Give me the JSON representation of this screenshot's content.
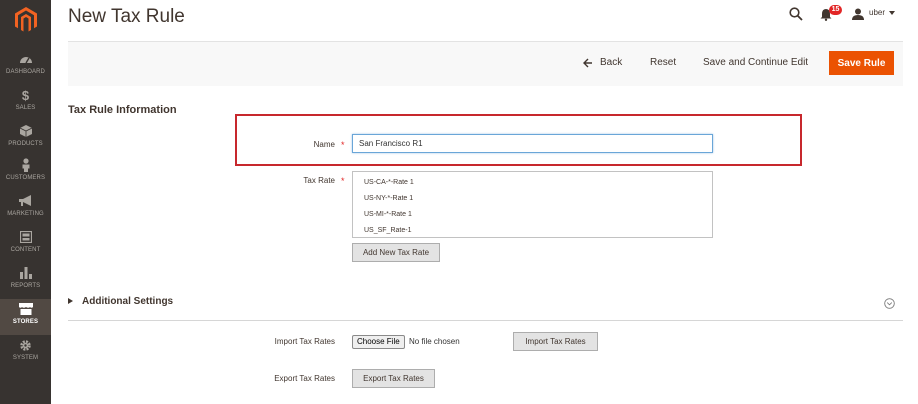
{
  "header": {
    "title": "New Tax Rule",
    "notifications_count": "15",
    "username": "uber"
  },
  "sidebar": {
    "items": [
      {
        "label": "DASHBOARD",
        "icon": "dashboard-icon"
      },
      {
        "label": "SALES",
        "icon": "dollar-icon"
      },
      {
        "label": "PRODUCTS",
        "icon": "cube-icon"
      },
      {
        "label": "CUSTOMERS",
        "icon": "person-icon"
      },
      {
        "label": "MARKETING",
        "icon": "megaphone-icon"
      },
      {
        "label": "CONTENT",
        "icon": "layout-icon"
      },
      {
        "label": "REPORTS",
        "icon": "bar-chart-icon"
      },
      {
        "label": "STORES",
        "icon": "store-icon",
        "active": true
      },
      {
        "label": "SYSTEM",
        "icon": "gear-icon"
      }
    ]
  },
  "actions": {
    "back": "Back",
    "reset": "Reset",
    "save_continue": "Save and Continue Edit",
    "save": "Save Rule"
  },
  "form": {
    "section_title": "Tax Rule Information",
    "name_label": "Name",
    "name_value": "San Francisco R1",
    "tax_rate_label": "Tax Rate",
    "tax_rates": [
      "US-CA-*-Rate 1",
      "US-NY-*-Rate 1",
      "US-MI-*-Rate 1",
      "US_SF_Rate-1"
    ],
    "add_rate_button": "Add New Tax Rate"
  },
  "additional": {
    "title": "Additional Settings"
  },
  "import_export": {
    "import_label": "Import Tax Rates",
    "choose_file": "Choose File",
    "no_file": "No file chosen",
    "import_button": "Import Tax Rates",
    "export_label": "Export Tax Rates",
    "export_button": "Export Tax Rates"
  },
  "colors": {
    "sidebar_bg": "#373330",
    "accent": "#eb5202",
    "highlight": "#c7282d",
    "badge": "#e22626"
  }
}
